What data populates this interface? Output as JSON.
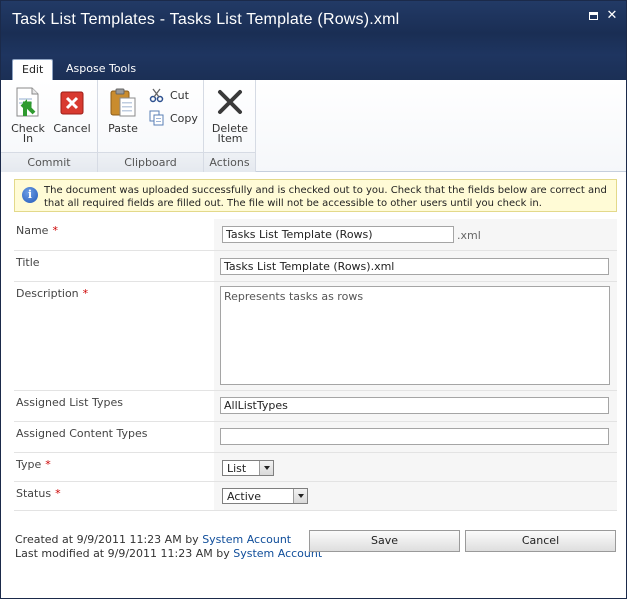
{
  "window": {
    "title": "Task List Templates - Tasks List Template (Rows).xml"
  },
  "tabs": [
    {
      "label": "Edit",
      "active": true
    },
    {
      "label": "Aspose Tools",
      "active": false
    }
  ],
  "ribbon": {
    "commit": {
      "label": "Commit",
      "check_in_line1": "Check",
      "check_in_line2": "In",
      "cancel": "Cancel"
    },
    "clipboard": {
      "label": "Clipboard",
      "paste": "Paste",
      "cut": "Cut",
      "copy": "Copy"
    },
    "actions": {
      "label": "Actions",
      "delete_line1": "Delete",
      "delete_line2": "Item"
    }
  },
  "info": {
    "message": "The document was uploaded successfully and is checked out to you. Check that the fields below are correct and that all required fields are filled out. The file will not be accessible to other users until you check in."
  },
  "form": {
    "name": {
      "label": "Name",
      "required": "*",
      "value": "Tasks List Template (Rows)",
      "suffix": ".xml"
    },
    "title": {
      "label": "Title",
      "value": "Tasks List Template (Rows).xml"
    },
    "description": {
      "label": "Description",
      "required": "*",
      "value": "Represents tasks as rows"
    },
    "assigned_list_types": {
      "label": "Assigned List Types",
      "value": "AllListTypes"
    },
    "assigned_content_types": {
      "label": "Assigned Content Types",
      "value": ""
    },
    "type": {
      "label": "Type",
      "required": "*",
      "value": "List"
    },
    "status": {
      "label": "Status",
      "required": "*",
      "value": "Active"
    }
  },
  "footer": {
    "created_prefix": "Created at 9/9/2011 11:23 AM  by",
    "created_by": "System Account",
    "modified_prefix": "Last modified at 9/9/2011 11:23 AM  by",
    "modified_by": "System Account",
    "save": "Save",
    "cancel": "Cancel"
  },
  "colors": {
    "titlebar": "#1e3560",
    "link": "#0f4d9a",
    "required": "#cc0000",
    "infobar": "#fffbd6"
  }
}
